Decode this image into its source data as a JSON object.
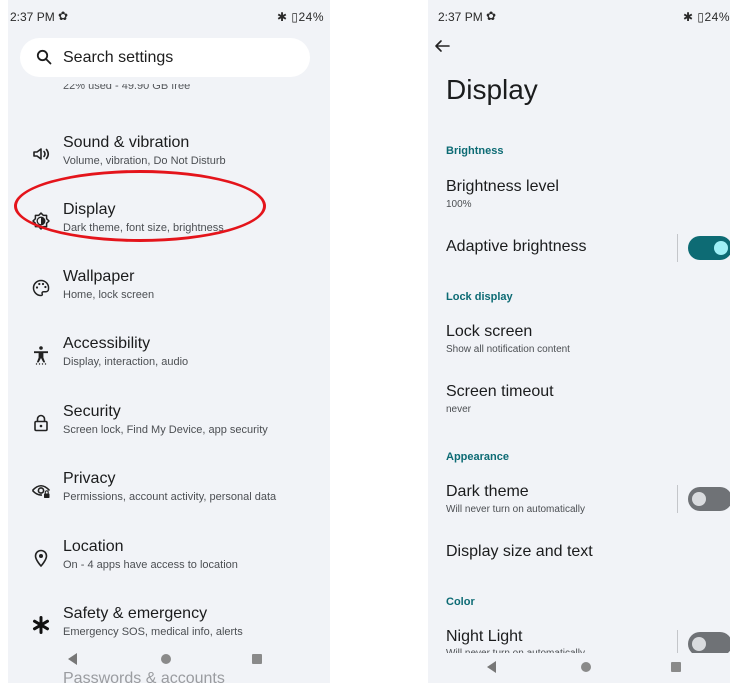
{
  "left_screen": {
    "status": {
      "time": "2:37 PM",
      "right": "✱ ▯24%"
    },
    "search": {
      "label": "Search settings"
    },
    "cutoff_text": "22% used - 49.90 GB free",
    "items": [
      {
        "title": "Sound & vibration",
        "subtitle": "Volume, vibration, Do Not Disturb",
        "icon": "speaker-icon"
      },
      {
        "title": "Display",
        "subtitle": "Dark theme, font size, brightness",
        "icon": "brightness-icon"
      },
      {
        "title": "Wallpaper",
        "subtitle": "Home, lock screen",
        "icon": "palette-icon"
      },
      {
        "title": "Accessibility",
        "subtitle": "Display, interaction, audio",
        "icon": "accessibility-icon"
      },
      {
        "title": "Security",
        "subtitle": "Screen lock, Find My Device, app security",
        "icon": "lock-icon"
      },
      {
        "title": "Privacy",
        "subtitle": "Permissions, account activity, personal data",
        "icon": "eye-icon"
      },
      {
        "title": "Location",
        "subtitle": "On - 4 apps have access to location",
        "icon": "location-pin-icon"
      },
      {
        "title": "Safety & emergency",
        "subtitle": "Emergency SOS, medical info, alerts",
        "icon": "asterisk-icon"
      }
    ],
    "bottom_cutoff": "Passwords & accounts",
    "highlight_color": "#e4141b"
  },
  "right_screen": {
    "status": {
      "time": "2:37 PM",
      "right": "✱ ▯24%"
    },
    "title": "Display",
    "sections": {
      "brightness": "Brightness",
      "lock_display": "Lock display",
      "appearance": "Appearance",
      "color": "Color"
    },
    "items": {
      "brightness_level": {
        "title": "Brightness level",
        "subtitle": "100%"
      },
      "adaptive_brightness": {
        "title": "Adaptive brightness",
        "enabled": true
      },
      "lock_screen": {
        "title": "Lock screen",
        "subtitle": "Show all notification content"
      },
      "screen_timeout": {
        "title": "Screen timeout",
        "subtitle": "never"
      },
      "dark_theme": {
        "title": "Dark theme",
        "subtitle": "Will never turn on automatically",
        "enabled": false
      },
      "display_size": {
        "title": "Display size and text"
      },
      "night_light": {
        "title": "Night Light",
        "subtitle": "Will never turn on automatically",
        "enabled": false
      }
    },
    "accent_color": "#0d6b74"
  }
}
